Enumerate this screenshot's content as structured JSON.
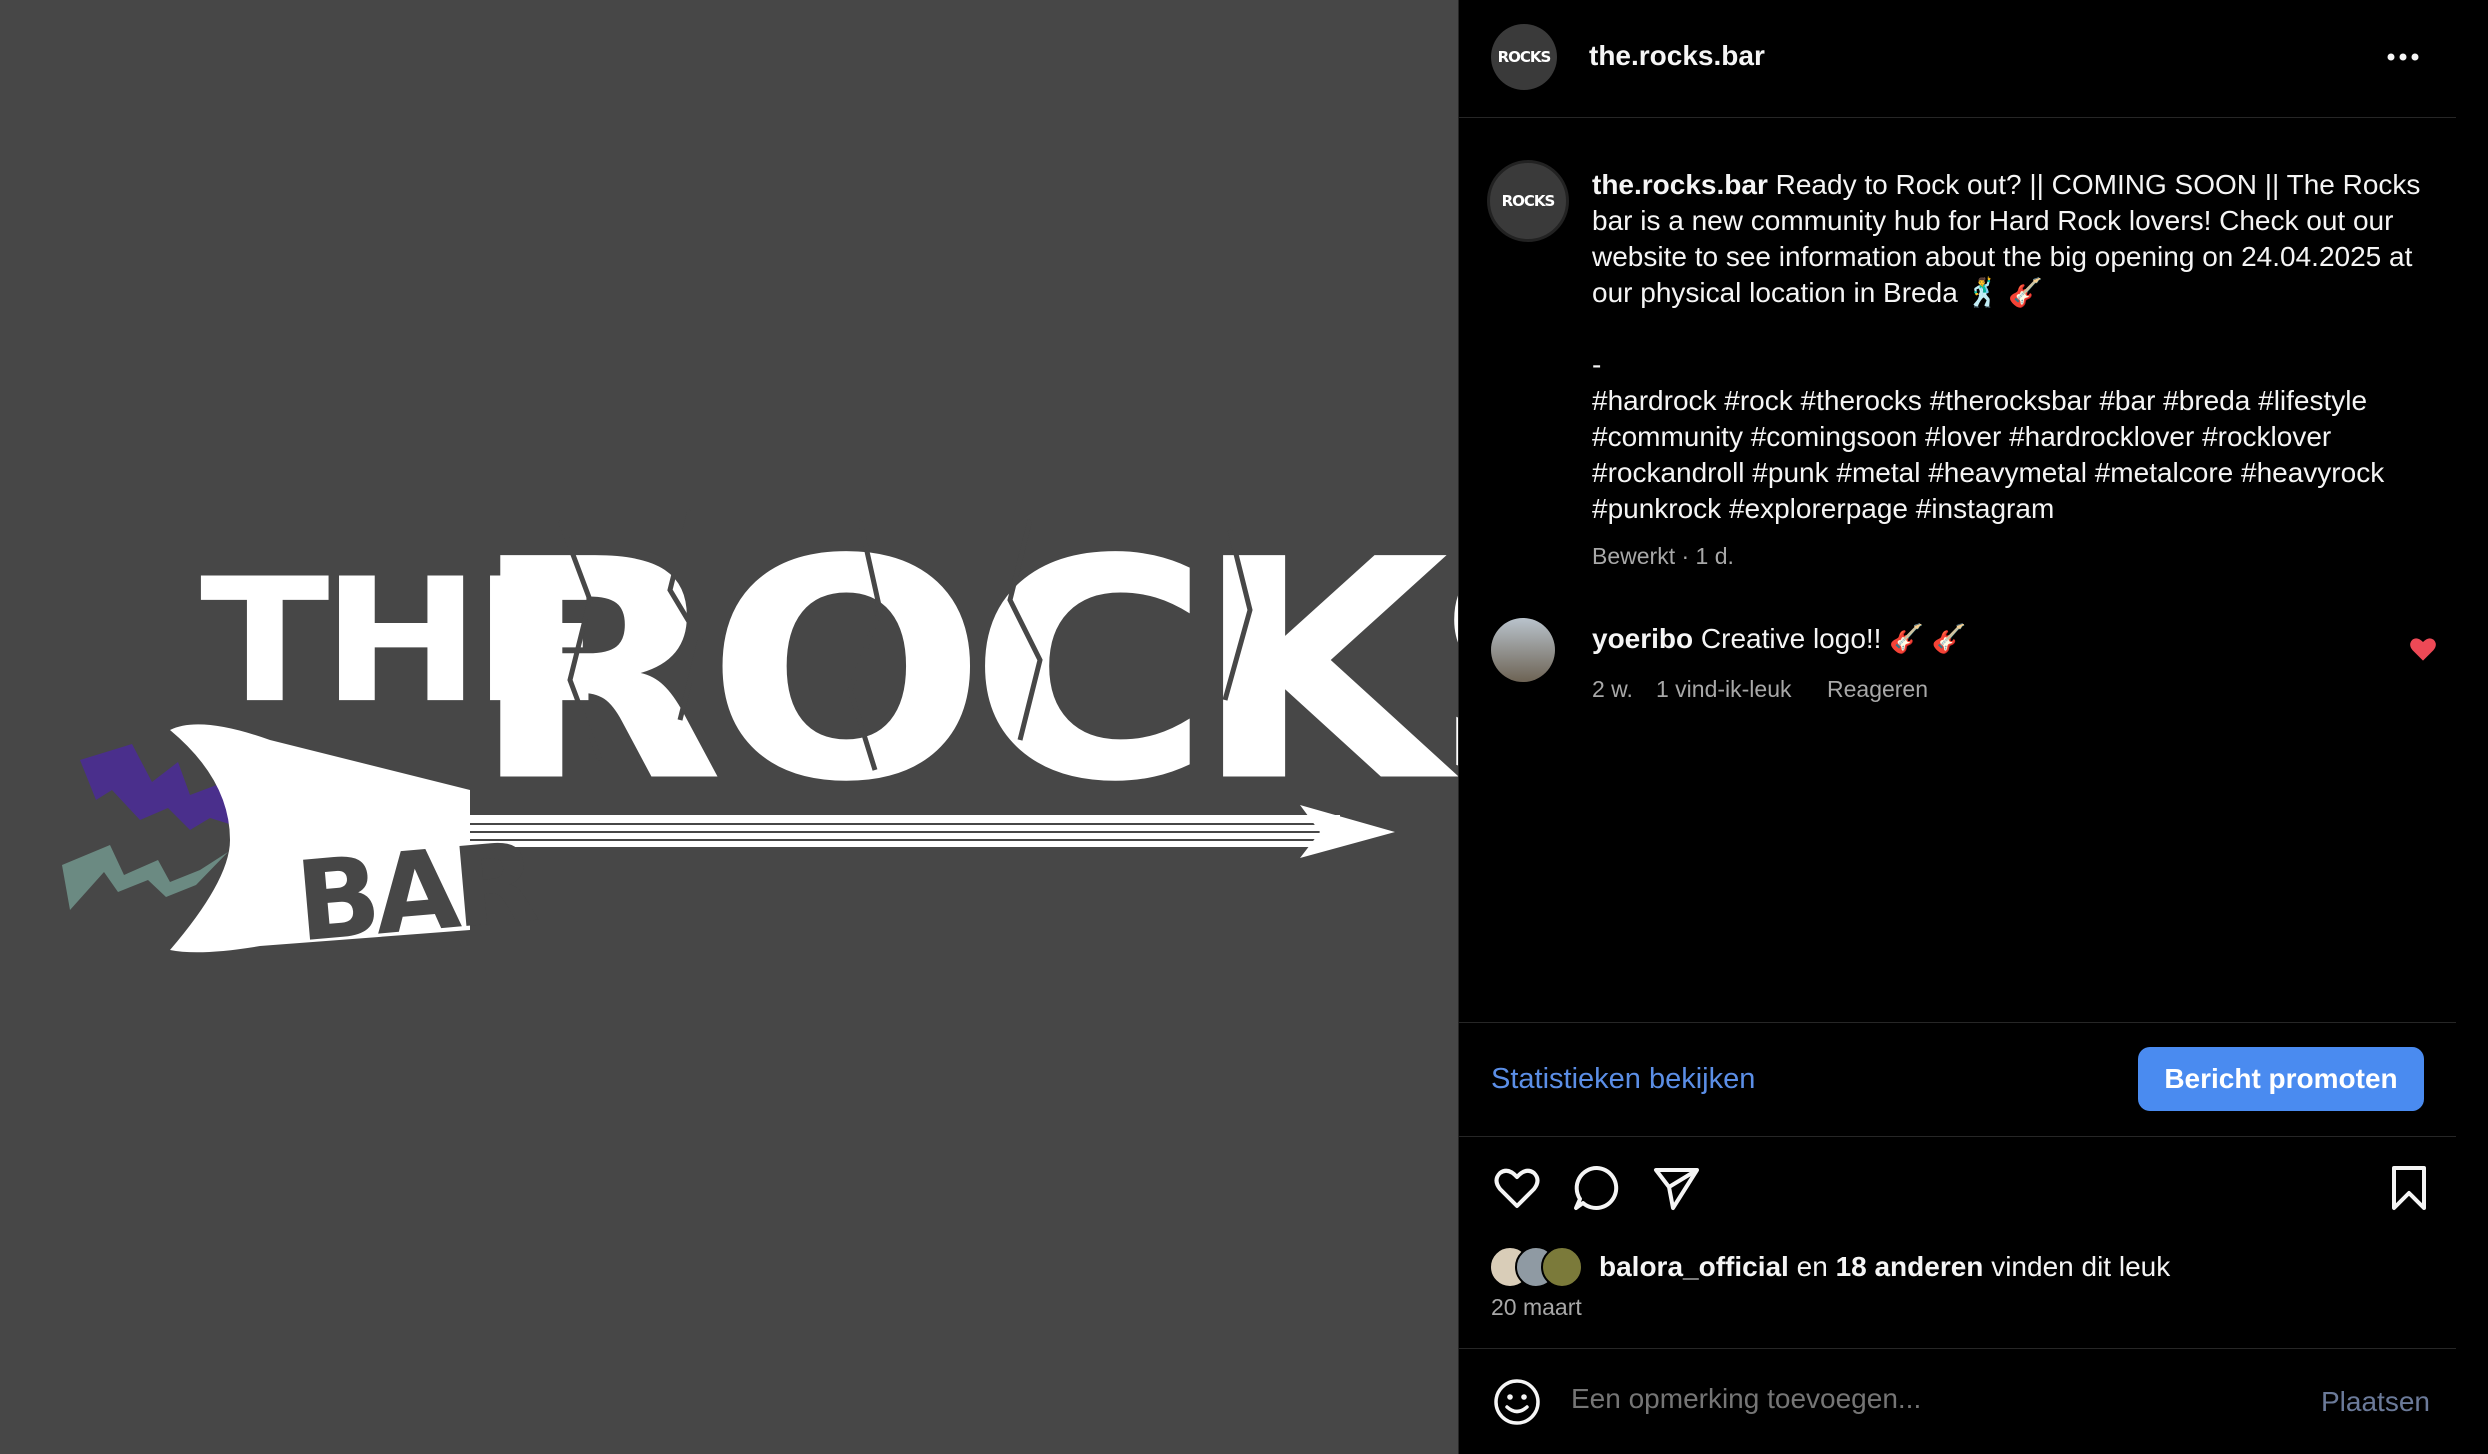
{
  "post": {
    "username": "the.rocks.bar",
    "avatar_text": "ROCKS",
    "caption_user": "the.rocks.bar",
    "caption_text": "Ready to Rock out? || COMING SOON || The Rocks bar is a new community hub for Hard Rock lovers! Check out our website to see information about the big opening on 24.04.2025 at our physical location in Breda 🕺 🎸",
    "caption_dash": "-",
    "hashtags": "#hardrock #rock #therocks #therocksbar #bar #breda #lifestyle #community #comingsoon #lover #hardrocklover #rocklover #rockandroll #punk #metal #heavymetal #metalcore #heavyrock #punkrock #explorerpage #instagram",
    "caption_meta": "Bewerkt · 1 d."
  },
  "logo": {
    "line1": "THE",
    "line2": "ROCKS",
    "line3": "BAR"
  },
  "comment": {
    "user": "yoeribo",
    "text": "Creative logo!! 🎸 🎸",
    "age": "2 w.",
    "likes": "1 vind-ik-leuk",
    "reply": "Reageren"
  },
  "actions": {
    "stats_link": "Statistieken bekijken",
    "promote_button": "Bericht promoten"
  },
  "likes": {
    "liker": "balora_official",
    "connector": "en",
    "others": "18 anderen",
    "suffix": "vinden dit leuk",
    "date": "20 maart"
  },
  "composer": {
    "placeholder": "Een opmerking toevoegen...",
    "post_label": "Plaatsen"
  },
  "colors": {
    "accent_blue": "#4a8bf0",
    "link_blue": "#5b8ee6",
    "like_red": "#ed4956",
    "media_bg": "#474747"
  }
}
